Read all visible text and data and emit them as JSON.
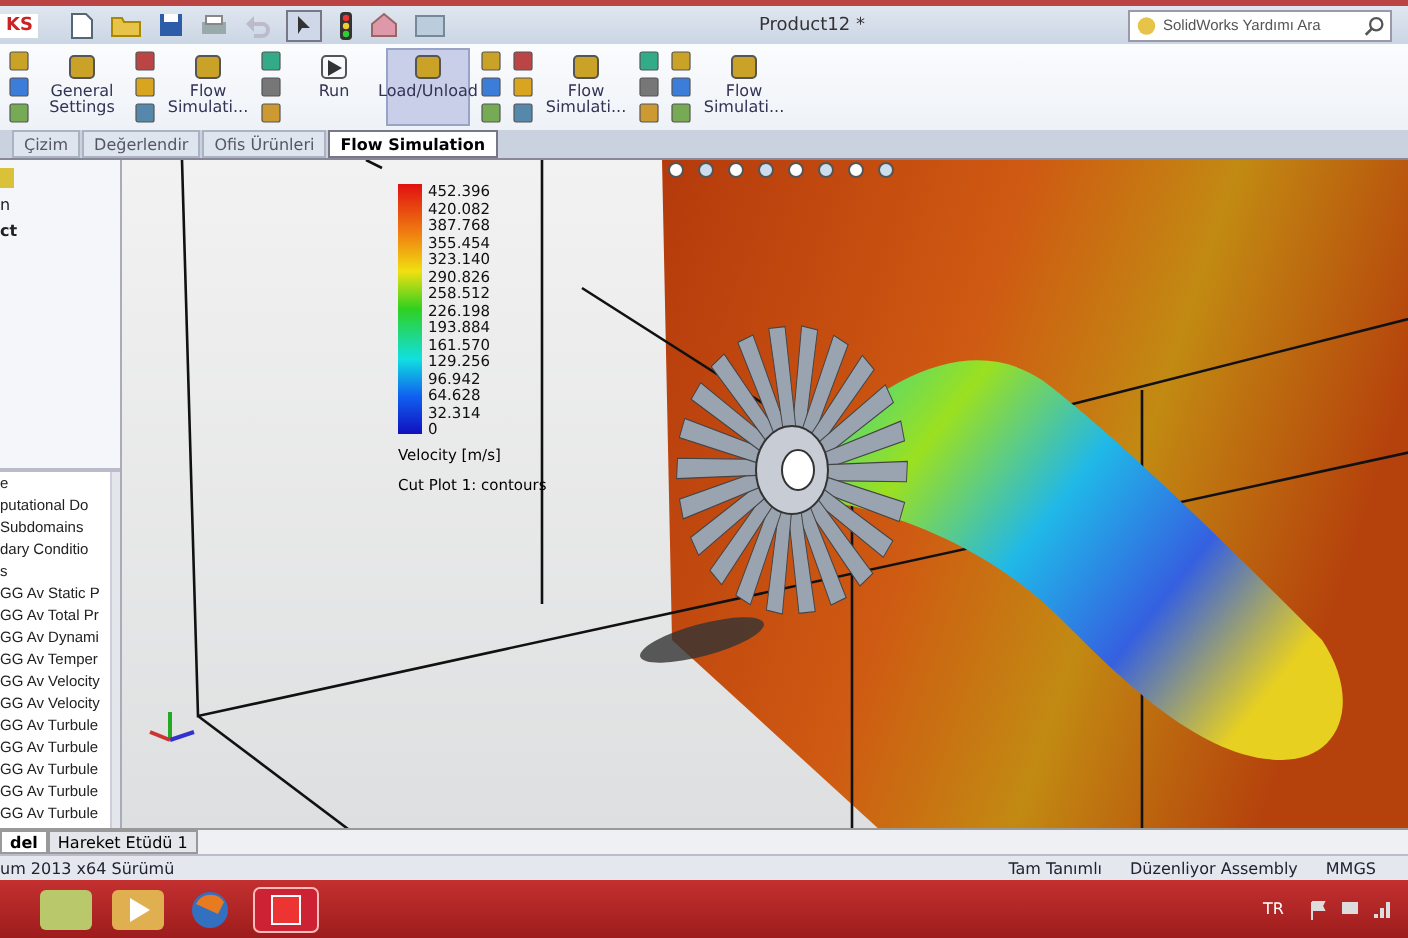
{
  "app_badge": "KS",
  "window": {
    "title": "Product12 *"
  },
  "search": {
    "placeholder": "SolidWorks Yardımı Ara"
  },
  "ribbon": {
    "buttons": [
      {
        "label": "General Settings",
        "selected": false
      },
      {
        "label": "Flow Simulati...",
        "selected": false
      },
      {
        "label": "Run",
        "selected": false
      },
      {
        "label": "Load/Unload",
        "selected": true
      },
      {
        "label": "Flow Simulati...",
        "selected": false
      },
      {
        "label": "Flow Simulati...",
        "selected": false
      }
    ]
  },
  "tabs": [
    {
      "label": "Çizim",
      "selected": false
    },
    {
      "label": "Değerlendir",
      "selected": false
    },
    {
      "label": "Ofis Ürünleri",
      "selected": false
    },
    {
      "label": "Flow Simulation",
      "selected": true
    }
  ],
  "feature_tree": {
    "items": [
      {
        "label": "n",
        "bold": false
      },
      {
        "label": "ct",
        "bold": true
      }
    ]
  },
  "analysis_tree": {
    "items": [
      "e",
      "putational Do",
      "Subdomains",
      "dary Conditio",
      "s",
      "GG Av Static P",
      "GG Av Total Pr",
      "GG Av Dynami",
      "GG Av Temper",
      "GG Av Velocity",
      "GG Av Velocity",
      "GG Av Turbule",
      "GG Av Turbule",
      "GG Av Turbule",
      "GG Av Turbule",
      "GG Av Turbule"
    ]
  },
  "legend": {
    "values": [
      "452.396",
      "420.082",
      "387.768",
      "355.454",
      "323.140",
      "290.826",
      "258.512",
      "226.198",
      "193.884",
      "161.570",
      "129.256",
      "96.942",
      "64.628",
      "32.314",
      "0"
    ],
    "title": "Velocity [m/s]",
    "caption": "Cut Plot 1: contours"
  },
  "model_tabs": [
    {
      "label": "del",
      "selected": true
    },
    {
      "label": "Hareket Etüdü 1",
      "selected": false
    }
  ],
  "status_bar": {
    "version": "um 2013 x64 Sürümü",
    "state": "Tam Tanımlı",
    "mode": "Düzenliyor Assembly",
    "units": "MMGS"
  },
  "taskbar": {
    "language": "TR"
  }
}
